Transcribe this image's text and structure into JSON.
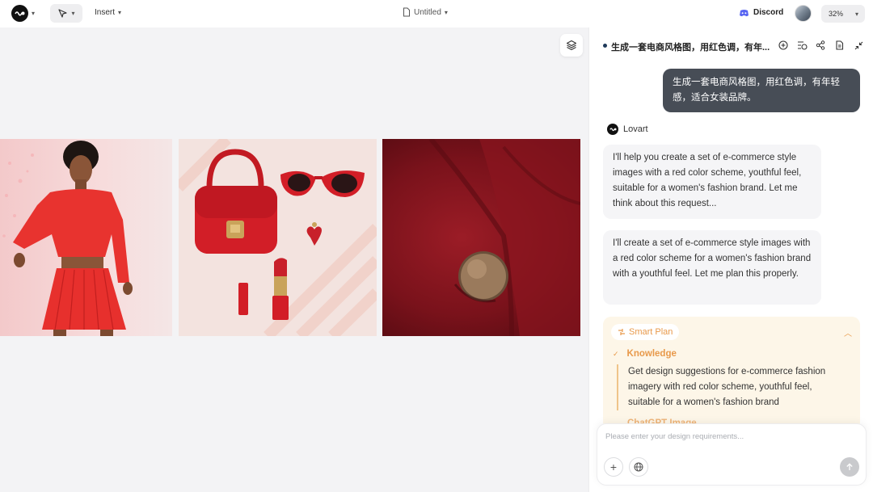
{
  "toolbar": {
    "insert_label": "Insert",
    "title": "Untitled",
    "discord_label": "Discord",
    "zoom": "32%"
  },
  "chat": {
    "title": "生成一套电商风格图，用红色调，有年...",
    "user_message": "生成一套电商风格图，用红色调，有年轻感，适合女装品牌。",
    "bot_name": "Lovart",
    "bot_messages": [
      "I'll help you create a set of e-commerce style images with a red color scheme, youthful feel, suitable for a women's fashion brand. Let me think about this request...",
      "I'll create a set of e-commerce style images with a red color scheme for a women's fashion brand with a youthful feel. Let me plan this properly."
    ],
    "plan": {
      "label": "Smart Plan",
      "step_title": "Knowledge",
      "step_text": "Get design suggestions for e-commerce fashion imagery with red color scheme, youthful feel, suitable for a women's fashion brand",
      "next_step": "ChatGPT Image"
    }
  },
  "input": {
    "placeholder": "Please enter your design requirements..."
  },
  "colors": {
    "accent_orange": "#e8994a",
    "user_bubble": "#474d56",
    "discord": "#5865f2",
    "product_red": "#d11f2b"
  }
}
